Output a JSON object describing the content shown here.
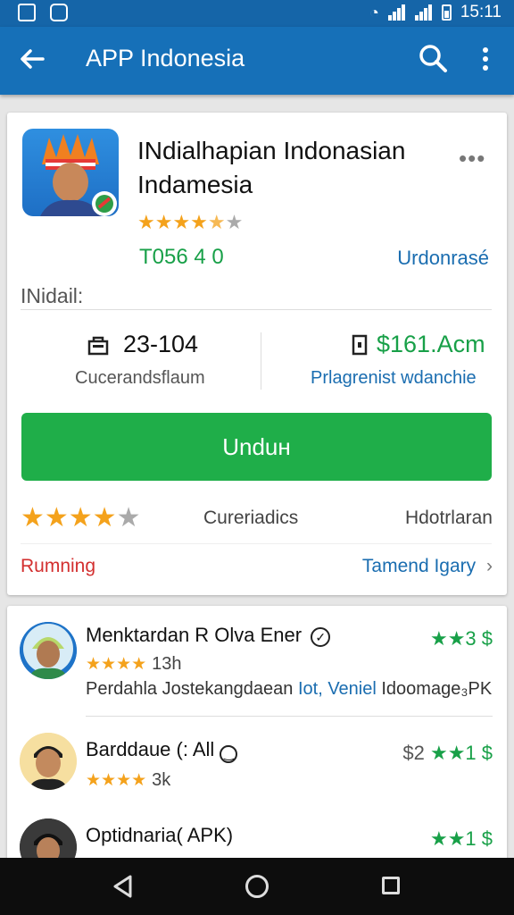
{
  "status_bar": {
    "time": "15:11"
  },
  "app_bar": {
    "title": "APP Indonesia",
    "back_icon": "arrow-left-icon",
    "search_icon": "search-icon",
    "menu_icon": "more-vert-icon"
  },
  "app": {
    "title": "INdialhapian Indonasian Indamesia",
    "rating_stars": 4.5,
    "price": "T056 4 0",
    "developer": "Urdonrasé",
    "section_label": "INidail:",
    "stat_left_value": "23-104",
    "stat_left_label": "Cucerandsflaum",
    "stat_right_value": "$161.Acm",
    "stat_right_label": "Prlagrenist wdanchie",
    "install_label": "Unduн",
    "rating_row_stars": 4,
    "rating_row_mid": "Cureriadics",
    "rating_row_right": "Hdotrlaran",
    "bottom_left": "Rumning",
    "bottom_right": "Tamend Igary",
    "chevron": "›"
  },
  "list": [
    {
      "name": "Menktardan R Olva Ener",
      "score": "★★3 $",
      "stars": 4,
      "meta": "13h",
      "desc_a": "Perdahla Jostekangdaean",
      "desc_link": "Iot, Veniel",
      "desc_b": "Idoomage₃PK"
    },
    {
      "name": "Barddaue (: All",
      "price_prefix": "$2",
      "score": "★★1 $",
      "stars": 4,
      "meta": "3k"
    },
    {
      "name": "Optidnaria( APK)",
      "score": "★★1 $"
    }
  ],
  "colors": {
    "app_bar": "#1670b8",
    "install_button": "#1fae49",
    "accent_blue": "#1a6db0",
    "green": "#18a048",
    "red": "#d32f2f",
    "star": "#f4a21c"
  }
}
